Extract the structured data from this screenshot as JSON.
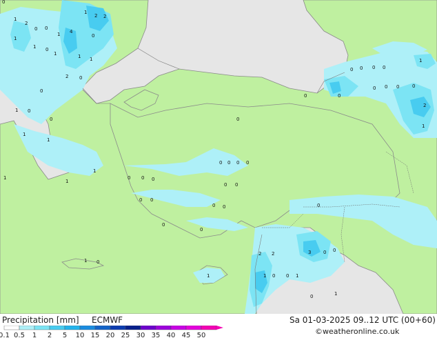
{
  "title": "Precipitation [mm]",
  "model": "ECMWF",
  "valid_time": "Sa 01-03-2025 09..12 UTC (00+60)",
  "credit": "©weatheronline.co.uk",
  "legend": {
    "ticks": [
      "0.1",
      "0.5",
      "1",
      "2",
      "5",
      "10",
      "15",
      "20",
      "25",
      "30",
      "35",
      "40",
      "45",
      "50"
    ],
    "colors": [
      "#ffffff",
      "#aef0f8",
      "#7ce4f4",
      "#48ccf0",
      "#24b4ec",
      "#1a8ce0",
      "#1464c8",
      "#0c3cb0",
      "#08208c",
      "#6c00cc",
      "#9c00dc",
      "#c800e4",
      "#e400dc",
      "#f400b4"
    ]
  },
  "colors": {
    "sea": "#e6e6e6",
    "land": "#bff0a0",
    "light_precip": "#aef0f8",
    "mid_precip": "#7ce4f4",
    "heavy_precip": "#48ccf0"
  },
  "map_labels": [
    "0",
    "2",
    "1",
    "2",
    "1",
    "2",
    "4",
    "0",
    "0",
    "1",
    "0",
    "1",
    "1",
    "0",
    "1",
    "1",
    "1",
    "0",
    "2",
    "0",
    "0",
    "1",
    "0",
    "1",
    "1",
    "1",
    "1",
    "1",
    "0",
    "0",
    "0",
    "0",
    "1",
    "2",
    "1",
    "0",
    "0",
    "0",
    "0",
    "0",
    "0",
    "0",
    "0",
    "0",
    "0",
    "0",
    "0",
    "0",
    "0",
    "0",
    "0",
    "0",
    "0",
    "0",
    "0",
    "0",
    "0",
    "2",
    "3",
    "0",
    "0",
    "2",
    "1",
    "0",
    "0",
    "1",
    "0",
    "0",
    "1",
    "1",
    "1",
    "0"
  ]
}
